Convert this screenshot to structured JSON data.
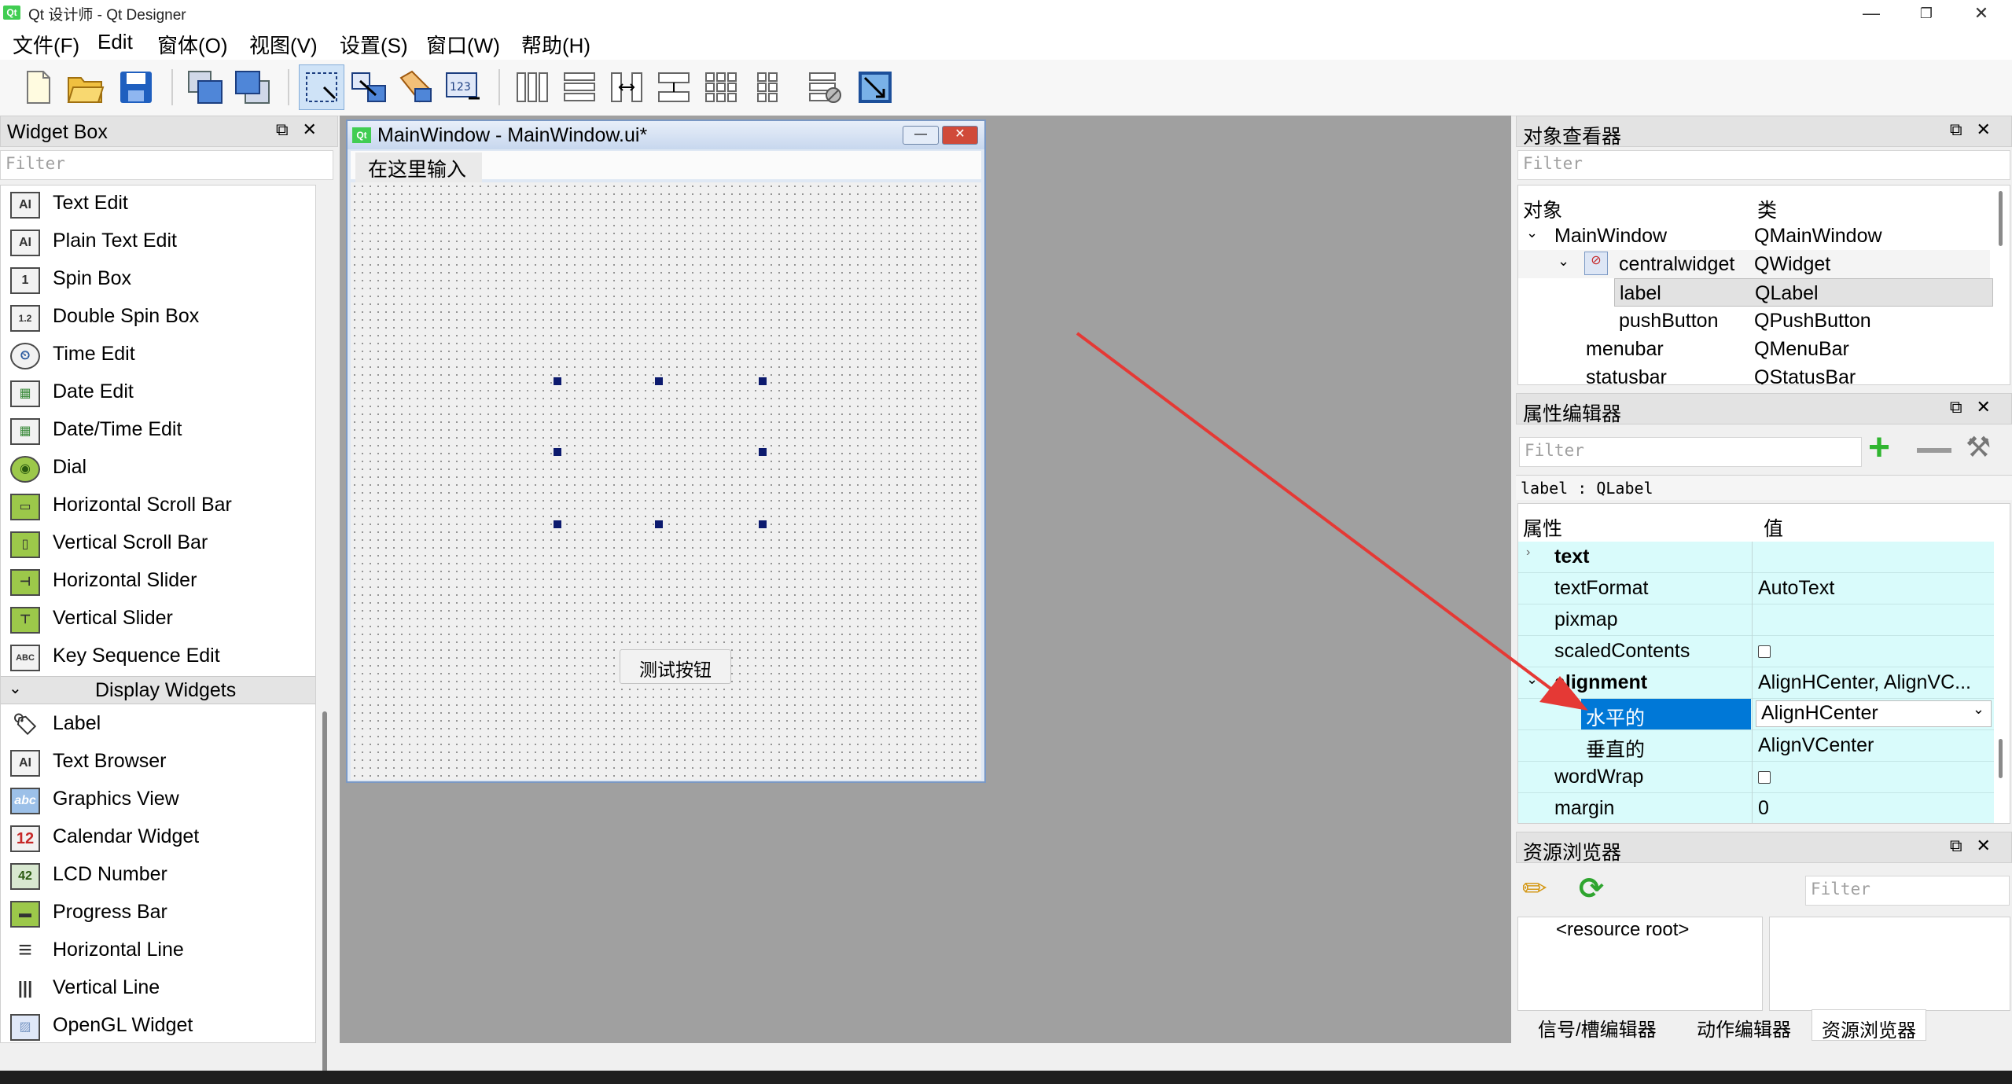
{
  "window": {
    "title": "Qt 设计师 - Qt Designer",
    "logo": "Qt"
  },
  "menubar": [
    "文件(F)",
    "Edit",
    "窗体(O)",
    "视图(V)",
    "设置(S)",
    "窗口(W)",
    "帮助(H)"
  ],
  "widget_box": {
    "title": "Widget Box",
    "filter_placeholder": "Filter",
    "items": [
      {
        "label": "Text Edit",
        "icon": "AI"
      },
      {
        "label": "Plain Text Edit",
        "icon": "AI"
      },
      {
        "label": "Spin Box",
        "icon": "1"
      },
      {
        "label": "Double Spin Box",
        "icon": "1.2"
      },
      {
        "label": "Time Edit",
        "icon": "⏲"
      },
      {
        "label": "Date Edit",
        "icon": "▦"
      },
      {
        "label": "Date/Time Edit",
        "icon": "▦"
      },
      {
        "label": "Dial",
        "icon": "◉"
      },
      {
        "label": "Horizontal Scroll Bar",
        "icon": "▭"
      },
      {
        "label": "Vertical Scroll Bar",
        "icon": "▯"
      },
      {
        "label": "Horizontal Slider",
        "icon": "⊣"
      },
      {
        "label": "Vertical Slider",
        "icon": "⊤"
      },
      {
        "label": "Key Sequence Edit",
        "icon": "ABC"
      }
    ],
    "category": "Display Widgets",
    "display_items": [
      {
        "label": "Label",
        "icon": "🏷"
      },
      {
        "label": "Text Browser",
        "icon": "AI"
      },
      {
        "label": "Graphics View",
        "icon": "abc"
      },
      {
        "label": "Calendar Widget",
        "icon": "12"
      },
      {
        "label": "LCD Number",
        "icon": "42"
      },
      {
        "label": "Progress Bar",
        "icon": "▬"
      },
      {
        "label": "Horizontal Line",
        "icon": "≡"
      },
      {
        "label": "Vertical Line",
        "icon": "|||"
      },
      {
        "label": "OpenGL Widget",
        "icon": "▨"
      }
    ]
  },
  "form": {
    "title": "MainWindow - MainWindow.ui*",
    "menu_placeholder": "在这里输入",
    "button_text": "测试按钮"
  },
  "object_inspector": {
    "title": "对象查看器",
    "filter_placeholder": "Filter",
    "col_object": "对象",
    "col_class": "类",
    "rows": [
      {
        "name": "MainWindow",
        "cls": "QMainWindow"
      },
      {
        "name": "centralwidget",
        "cls": "QWidget"
      },
      {
        "name": "label",
        "cls": "QLabel"
      },
      {
        "name": "pushButton",
        "cls": "QPushButton"
      },
      {
        "name": "menubar",
        "cls": "QMenuBar"
      },
      {
        "name": "statusbar",
        "cls": "QStatusBar"
      }
    ]
  },
  "property_editor": {
    "title": "属性编辑器",
    "filter_placeholder": "Filter",
    "context": "label : QLabel",
    "col_property": "属性",
    "col_value": "值",
    "rows": [
      {
        "name": "text",
        "value": ""
      },
      {
        "name": "textFormat",
        "value": "AutoText"
      },
      {
        "name": "pixmap",
        "value": ""
      },
      {
        "name": "scaledContents",
        "value": ""
      },
      {
        "name": "alignment",
        "value": "AlignHCenter, AlignVC..."
      },
      {
        "name": "水平的",
        "value": "AlignHCenter"
      },
      {
        "name": "垂直的",
        "value": "AlignVCenter"
      },
      {
        "name": "wordWrap",
        "value": ""
      },
      {
        "name": "margin",
        "value": "0"
      }
    ]
  },
  "resource_browser": {
    "title": "资源浏览器",
    "filter_placeholder": "Filter",
    "root": "<resource root>",
    "tabs": [
      "信号/槽编辑器",
      "动作编辑器",
      "资源浏览器"
    ]
  },
  "colors": {
    "arrow": "#e53935",
    "selection": "#0078d7",
    "prop_row": "#d9fbfb"
  }
}
